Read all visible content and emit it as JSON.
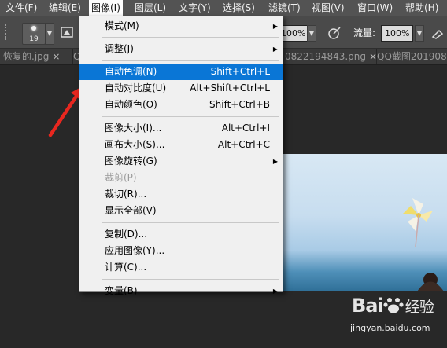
{
  "menubar": {
    "items": [
      {
        "label": "文件(F)"
      },
      {
        "label": "编辑(E)"
      },
      {
        "label": "图像(I)"
      },
      {
        "label": "图层(L)"
      },
      {
        "label": "文字(Y)"
      },
      {
        "label": "选择(S)"
      },
      {
        "label": "滤镜(T)"
      },
      {
        "label": "视图(V)"
      },
      {
        "label": "窗口(W)"
      },
      {
        "label": "帮助(H)"
      }
    ],
    "active_index": 2
  },
  "options_bar": {
    "brush_size": "19",
    "opacity_value": "100%",
    "flow_label": "流量:",
    "flow_value": "100%"
  },
  "tabs": [
    {
      "label": "恢复的.jpg"
    },
    {
      "label": "QQ"
    },
    {
      "label": "0822194843.png"
    },
    {
      "label": "QQ截图201908"
    }
  ],
  "image_menu": {
    "items": [
      {
        "label": "模式(M)",
        "shortcut": "",
        "submenu": true
      },
      {
        "label": "调整(J)",
        "shortcut": "",
        "submenu": true
      },
      {
        "label": "自动色调(N)",
        "shortcut": "Shift+Ctrl+L"
      },
      {
        "label": "自动对比度(U)",
        "shortcut": "Alt+Shift+Ctrl+L"
      },
      {
        "label": "自动颜色(O)",
        "shortcut": "Shift+Ctrl+B"
      },
      {
        "label": "图像大小(I)...",
        "shortcut": "Alt+Ctrl+I"
      },
      {
        "label": "画布大小(S)...",
        "shortcut": "Alt+Ctrl+C"
      },
      {
        "label": "图像旋转(G)",
        "shortcut": "",
        "submenu": true
      },
      {
        "label": "裁剪(P)",
        "shortcut": "",
        "disabled": true
      },
      {
        "label": "裁切(R)...",
        "shortcut": ""
      },
      {
        "label": "显示全部(V)",
        "shortcut": ""
      },
      {
        "label": "复制(D)...",
        "shortcut": ""
      },
      {
        "label": "应用图像(Y)...",
        "shortcut": ""
      },
      {
        "label": "计算(C)...",
        "shortcut": ""
      },
      {
        "label": "变量(B)",
        "shortcut": "",
        "submenu": true
      }
    ],
    "highlighted_index": 2
  },
  "watermark": {
    "brand": "Bai",
    "brand_cn": "经验",
    "url": "jingyan.baidu.com"
  },
  "colors": {
    "menu_highlight": "#0a76d6",
    "annotation_arrow": "#e8271f",
    "ui_dark": "#535353"
  }
}
